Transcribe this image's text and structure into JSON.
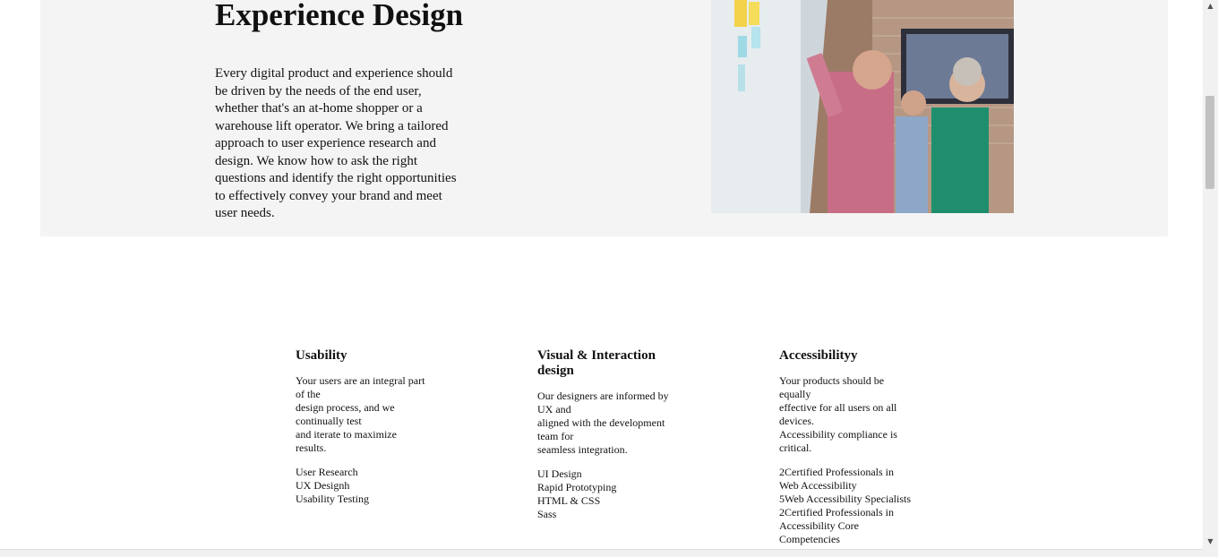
{
  "hero": {
    "title": "Experience Design",
    "body": "Every digital product and experience should be driven by the needs of the end user, whether that's an at-home shopper or a warehouse lift operator. We bring a tailored approach to user experience research and design. We know how to ask the right questions and identify the right opportunities to effectively convey your brand and meet user needs.",
    "photo_icon": "team-planning-photo"
  },
  "columns": [
    {
      "title": "Usability",
      "desc": [
        "Your users are an integral part of the",
        "design process, and we continually test",
        "and iterate to maximize results."
      ],
      "items": [
        "User Research",
        "UX Designh",
        "Usability Testing"
      ]
    },
    {
      "title": "Visual & Interaction design",
      "desc": [
        "Our designers are informed by UX and",
        "aligned with the development team for",
        "seamless integration."
      ],
      "items": [
        "UI Design",
        "Rapid Prototyping",
        "HTML & CSS",
        "Sass"
      ]
    },
    {
      "title": "Accessibilityy",
      "desc": [
        "Your products should be equally",
        "effective for all users on all devices.",
        "Accessibility compliance is critical."
      ],
      "items": [
        "2Certified Professionals in Web Accessibility",
        "5Web Accessibility Specialists",
        "2Certified Professionals in Accessibility Core Competencies"
      ]
    }
  ],
  "scrollbar": {
    "up_icon": "▲",
    "down_icon": "▼"
  }
}
